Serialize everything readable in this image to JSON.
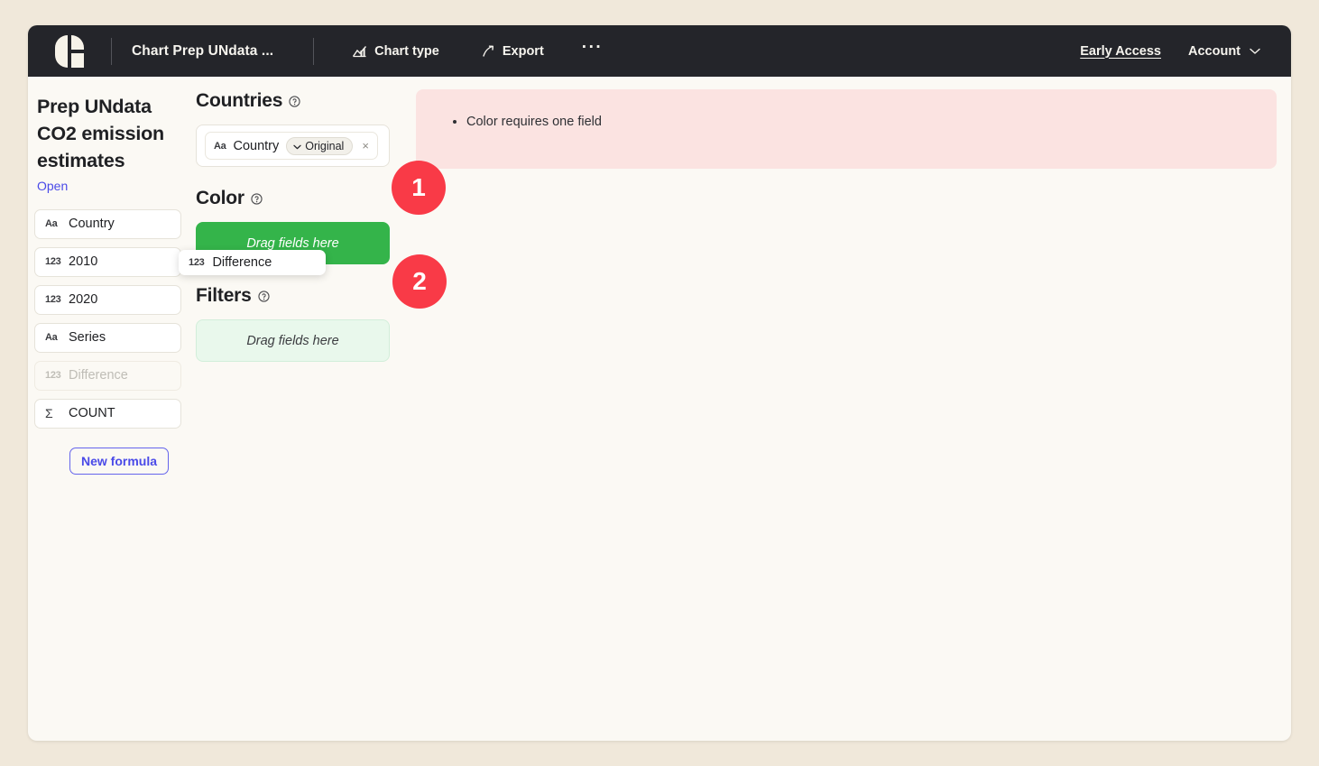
{
  "app": {
    "logo_icon": "app-logo-icon",
    "document_title": "Chart Prep UNdata ...",
    "chart_type_label": "Chart type",
    "chart_type_icon": "chart-type-icon",
    "export_label": "Export",
    "export_icon": "export-arrow-icon",
    "more_label": "···",
    "early_access_label": "Early Access",
    "account_label": "Account",
    "account_chevron_icon": "chevron-down-icon"
  },
  "sidebar": {
    "title": "Prep UNdata CO2 emission estimates",
    "open_link": "Open",
    "fields": [
      {
        "icon": "text-field-icon",
        "icon_glyph": "Aa",
        "label": "Country",
        "state": "normal"
      },
      {
        "icon": "number-field-icon",
        "icon_glyph": "123",
        "label": "2010",
        "state": "normal"
      },
      {
        "icon": "number-field-icon",
        "icon_glyph": "123",
        "label": "2020",
        "state": "normal"
      },
      {
        "icon": "text-field-icon",
        "icon_glyph": "Aa",
        "label": "Series",
        "state": "normal"
      },
      {
        "icon": "number-field-icon",
        "icon_glyph": "123",
        "label": "Difference",
        "state": "dragging"
      },
      {
        "icon": "aggregate-field-icon",
        "icon_glyph": "Σ",
        "label": "COUNT",
        "state": "normal"
      }
    ],
    "new_formula_label": "New formula"
  },
  "shelves": [
    {
      "name": "countries",
      "title": "Countries",
      "help_icon": "help-circle-icon",
      "state": "filled",
      "pill": {
        "icon_glyph": "Aa",
        "icon": "text-field-icon",
        "label": "Country",
        "sub_pill_label": "Original",
        "sub_pill_icon": "chevron-down-icon",
        "remove_icon": "close-icon",
        "remove_glyph": "×"
      }
    },
    {
      "name": "color",
      "title": "Color",
      "help_icon": "help-circle-icon",
      "state": "active",
      "placeholder": "Drag fields here"
    },
    {
      "name": "filters",
      "title": "Filters",
      "help_icon": "help-circle-icon",
      "state": "empty",
      "placeholder": "Drag fields here"
    }
  ],
  "main": {
    "errors": [
      "Color requires one field"
    ]
  },
  "overlays": {
    "drag_ghost": {
      "icon_glyph": "123",
      "label": "Difference"
    },
    "badges": [
      {
        "id": "1",
        "label": "1"
      },
      {
        "id": "2",
        "label": "2"
      }
    ]
  },
  "colors": {
    "page_background": "#F0E8DA",
    "window_background": "#FBF9F4",
    "topbar": "#24252A",
    "accent_link": "#4A4AE8",
    "active_drop": "#34B44A",
    "empty_drop": "#E9F8EC",
    "error_background": "#FBE3E1",
    "badge_red": "#F93A47"
  }
}
